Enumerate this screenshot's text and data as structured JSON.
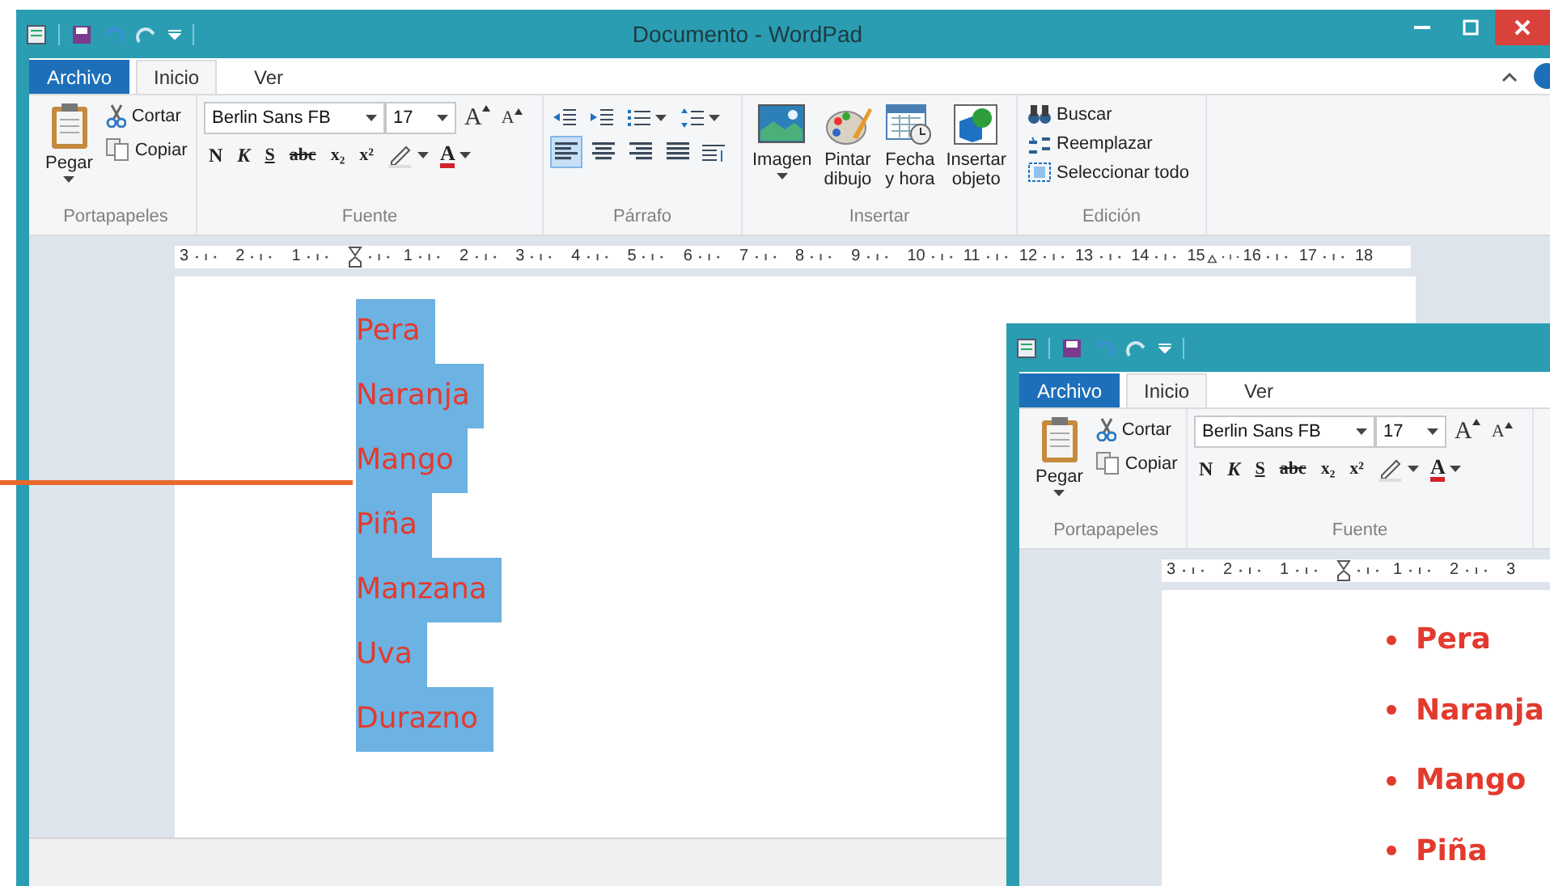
{
  "window": {
    "title": "Documento - WordPad"
  },
  "tabs": [
    {
      "label": "Archivo",
      "kind": "file",
      "selected": false
    },
    {
      "label": "Inicio",
      "kind": "tab",
      "selected": true
    },
    {
      "label": "Ver",
      "kind": "tab",
      "selected": false
    }
  ],
  "clipboard": {
    "label": "Portapapeles",
    "paste": "Pegar",
    "cut": "Cortar",
    "copy": "Copiar"
  },
  "font": {
    "label": "Fuente",
    "family": "Berlin Sans FB",
    "size": "17",
    "grow": "A",
    "shrink": "A",
    "color_button": "A",
    "styles": [
      {
        "kind": "bold",
        "text": "N"
      },
      {
        "kind": "italic",
        "text": "K"
      },
      {
        "kind": "underline",
        "text": "S"
      },
      {
        "kind": "strike",
        "text": "abc"
      },
      {
        "kind": "sub",
        "text": "x₂"
      },
      {
        "kind": "sup",
        "text": "x²"
      }
    ]
  },
  "paragraph": {
    "label": "Párrafo",
    "alignment": [
      {
        "kind": "left",
        "selected": true
      },
      {
        "kind": "center",
        "selected": false
      },
      {
        "kind": "right",
        "selected": false
      },
      {
        "kind": "justify",
        "selected": false
      }
    ]
  },
  "insert": {
    "label": "Insertar",
    "buttons": [
      {
        "kind": "picture",
        "label": "Imagen",
        "dropdown": true
      },
      {
        "kind": "paint",
        "label": "Pintar dibujo",
        "dropdown": false
      },
      {
        "kind": "datetime",
        "label": "Fecha y hora",
        "dropdown": false
      },
      {
        "kind": "object",
        "label": "Insertar objeto",
        "dropdown": false
      }
    ]
  },
  "editing": {
    "label": "Edición",
    "buttons": [
      {
        "kind": "find",
        "label": "Buscar"
      },
      {
        "kind": "replace",
        "label": "Reemplazar"
      },
      {
        "kind": "select",
        "label": "Seleccionar todo"
      }
    ]
  },
  "ruler": [
    {
      "kind": "number",
      "label": "3"
    },
    {
      "kind": "number",
      "label": "2"
    },
    {
      "kind": "number",
      "label": "1"
    },
    {
      "kind": "indent"
    },
    {
      "kind": "number",
      "label": "1"
    },
    {
      "kind": "number",
      "label": "2"
    },
    {
      "kind": "number",
      "label": "3"
    },
    {
      "kind": "number",
      "label": "4"
    },
    {
      "kind": "number",
      "label": "5"
    },
    {
      "kind": "number",
      "label": "6"
    },
    {
      "kind": "number",
      "label": "7"
    },
    {
      "kind": "number",
      "label": "8"
    },
    {
      "kind": "number",
      "label": "9"
    },
    {
      "kind": "number",
      "label": "10"
    },
    {
      "kind": "number",
      "label": "11"
    },
    {
      "kind": "number",
      "label": "12"
    },
    {
      "kind": "number",
      "label": "13"
    },
    {
      "kind": "number",
      "label": "14"
    },
    {
      "kind": "right_indent",
      "label": "15"
    },
    {
      "kind": "number",
      "label": "16"
    },
    {
      "kind": "number",
      "label": "17"
    },
    {
      "kind": "number",
      "label": "18"
    }
  ],
  "document": {
    "items": [
      {
        "text": "Pera",
        "selected": true
      },
      {
        "text": "Naranja",
        "selected": true
      },
      {
        "text": "Mango",
        "selected": true
      },
      {
        "text": "Piña",
        "selected": true
      },
      {
        "text": "Manzana",
        "selected": true
      },
      {
        "text": "Uva",
        "selected": true
      },
      {
        "text": "Durazno",
        "selected": true
      }
    ]
  },
  "inset": {
    "tabs": [
      {
        "label": "Archivo",
        "kind": "file",
        "selected": false
      },
      {
        "label": "Inicio",
        "kind": "tab",
        "selected": true
      },
      {
        "label": "Ver",
        "kind": "tab",
        "selected": false
      }
    ],
    "clipboard": {
      "label": "Portapapeles",
      "paste": "Pegar",
      "cut": "Cortar",
      "copy": "Copiar"
    },
    "font": {
      "label": "Fuente",
      "family": "Berlin Sans FB",
      "size": "17",
      "grow": "A",
      "shrink": "A",
      "color_button": "A",
      "styles": [
        {
          "kind": "bold",
          "text": "N"
        },
        {
          "kind": "italic",
          "text": "K"
        },
        {
          "kind": "underline",
          "text": "S"
        },
        {
          "kind": "strike",
          "text": "abc"
        },
        {
          "kind": "sub",
          "text": "x₂"
        },
        {
          "kind": "sup",
          "text": "x²"
        }
      ]
    },
    "ruler": [
      {
        "kind": "number",
        "label": "3"
      },
      {
        "kind": "number",
        "label": "2"
      },
      {
        "kind": "number",
        "label": "1"
      },
      {
        "kind": "indent"
      },
      {
        "kind": "number",
        "label": "1"
      },
      {
        "kind": "number",
        "label": "2"
      },
      {
        "kind": "number",
        "label": "3"
      }
    ],
    "document": {
      "items": [
        {
          "text": "Pera",
          "bulleted": true
        },
        {
          "text": "Naranja",
          "bulleted": true
        },
        {
          "text": "Mango",
          "bulleted": true
        },
        {
          "text": "Piña",
          "bulleted": true
        }
      ]
    }
  }
}
